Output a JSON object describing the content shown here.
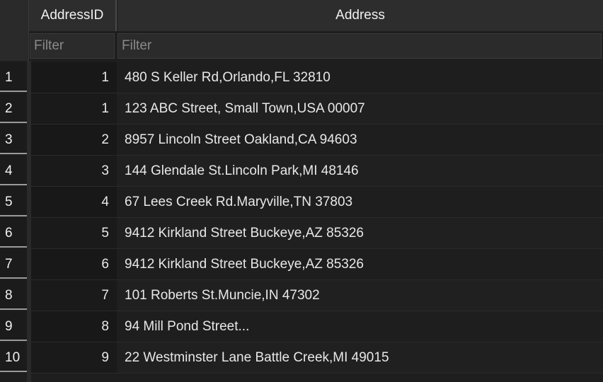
{
  "columns": {
    "id_header": "AddressID",
    "address_header": "Address",
    "id_filter_placeholder": "Filter",
    "address_filter_placeholder": "Filter"
  },
  "rows": [
    {
      "num": "1",
      "id": "1",
      "address": "480 S Keller Rd,Orlando,FL 32810"
    },
    {
      "num": "2",
      "id": "1",
      "address": "123 ABC Street, Small Town,USA 00007"
    },
    {
      "num": "3",
      "id": "2",
      "address": "8957 Lincoln Street Oakland,CA 94603"
    },
    {
      "num": "4",
      "id": "3",
      "address": "144 Glendale St.Lincoln Park,MI 48146"
    },
    {
      "num": "5",
      "id": "4",
      "address": "67 Lees Creek Rd.Maryville,TN 37803"
    },
    {
      "num": "6",
      "id": "5",
      "address": "9412 Kirkland Street Buckeye,AZ 85326"
    },
    {
      "num": "7",
      "id": "6",
      "address": "9412 Kirkland Street Buckeye,AZ 85326"
    },
    {
      "num": "8",
      "id": "7",
      "address": "101 Roberts St.Muncie,IN 47302"
    },
    {
      "num": "9",
      "id": "8",
      "address": "94 Mill Pond Street..."
    },
    {
      "num": "10",
      "id": "9",
      "address": "22 Westminster Lane Battle Creek,MI 49015"
    }
  ]
}
